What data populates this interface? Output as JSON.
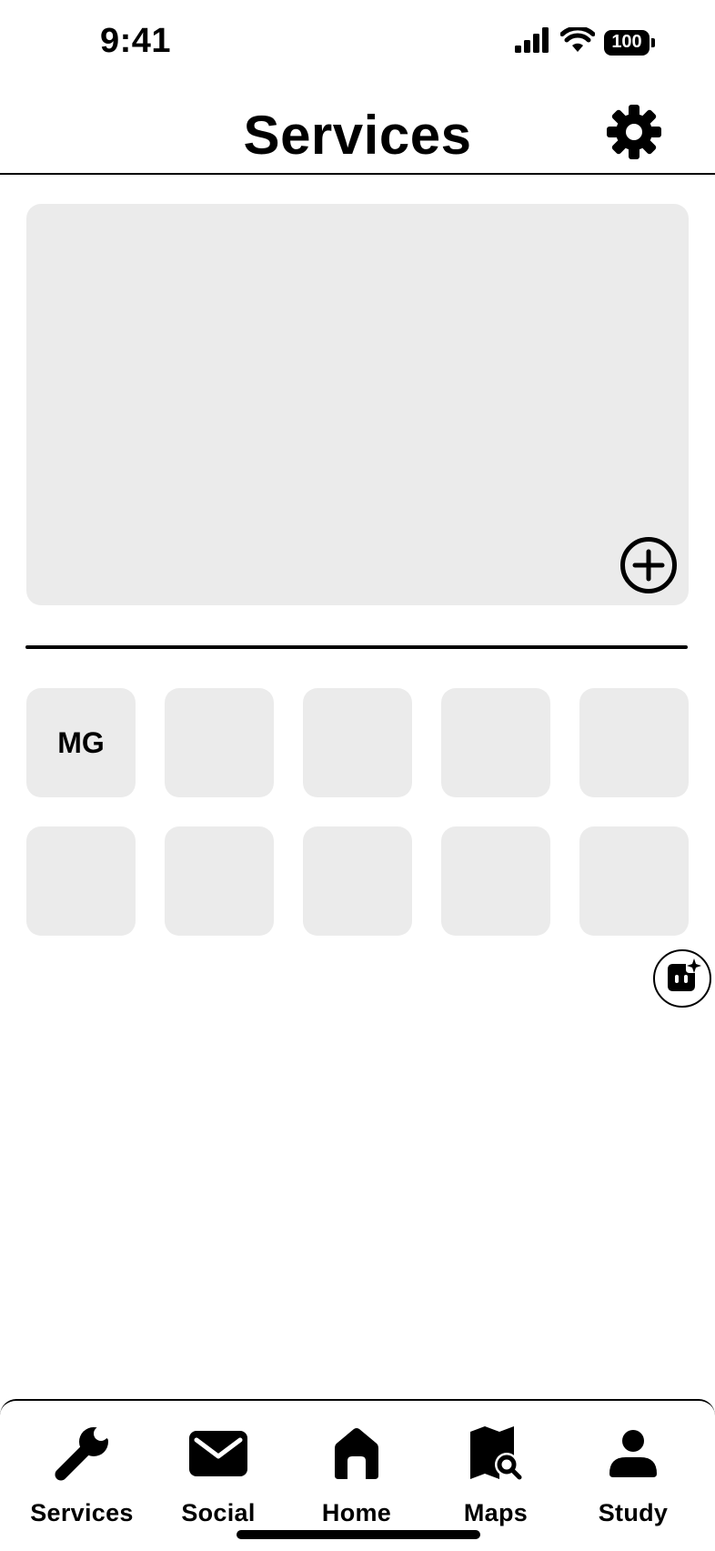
{
  "status_bar": {
    "time": "9:41",
    "battery": "100",
    "icons": [
      "cellular-signal-icon",
      "wifi-icon",
      "battery-icon"
    ]
  },
  "header": {
    "title": "Services",
    "settings_icon": "gear-icon"
  },
  "feature_card": {
    "add_icon": "plus-circle-icon"
  },
  "tiles": [
    {
      "label": "MG"
    },
    {
      "label": ""
    },
    {
      "label": ""
    },
    {
      "label": ""
    },
    {
      "label": ""
    },
    {
      "label": ""
    },
    {
      "label": ""
    },
    {
      "label": ""
    },
    {
      "label": ""
    },
    {
      "label": ""
    }
  ],
  "assistant": {
    "icon": "ai-assistant-icon"
  },
  "bottom_nav": {
    "items": [
      {
        "label": "Services",
        "icon": "wrench-icon"
      },
      {
        "label": "Social",
        "icon": "mail-icon"
      },
      {
        "label": "Home",
        "icon": "home-icon"
      },
      {
        "label": "Maps",
        "icon": "map-search-icon"
      },
      {
        "label": "Study",
        "icon": "person-icon"
      }
    ]
  },
  "colors": {
    "background": "#ffffff",
    "card": "#ebebeb",
    "foreground": "#000000"
  }
}
